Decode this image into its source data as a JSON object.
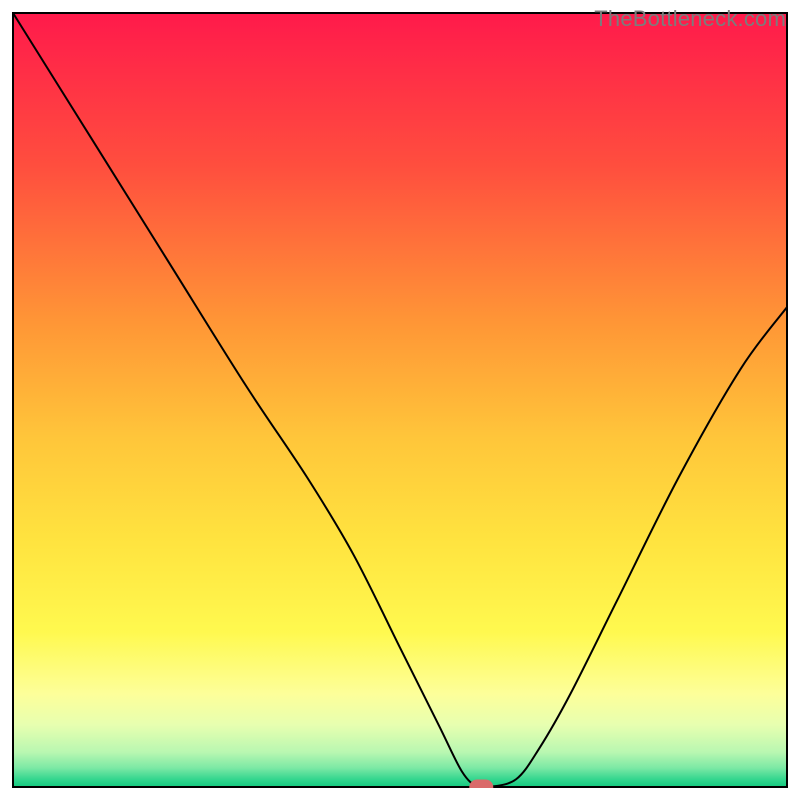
{
  "watermark": "TheBottleneck.com",
  "chart_data": {
    "type": "line",
    "title": "",
    "xlabel": "",
    "ylabel": "",
    "xlim": [
      0,
      100
    ],
    "ylim": [
      0,
      100
    ],
    "grid": false,
    "legend": null,
    "series": [
      {
        "name": "curve",
        "x": [
          0,
          10,
          20,
          30,
          38,
          44,
          50,
          55,
          58,
          60,
          61.5,
          65,
          68,
          72,
          78,
          86,
          94,
          100
        ],
        "y": [
          100,
          84,
          68,
          52,
          40,
          30,
          18,
          8,
          2,
          0,
          0,
          1,
          5,
          12,
          24,
          40,
          54,
          62
        ]
      }
    ],
    "marker": {
      "x": 60.5,
      "y": 0
    },
    "background": {
      "type": "vertical-gradient",
      "stops": [
        {
          "pos": 0.0,
          "color": "#ff1a4b"
        },
        {
          "pos": 0.2,
          "color": "#ff4f3e"
        },
        {
          "pos": 0.4,
          "color": "#ff9636"
        },
        {
          "pos": 0.55,
          "color": "#ffc63a"
        },
        {
          "pos": 0.68,
          "color": "#ffe33f"
        },
        {
          "pos": 0.8,
          "color": "#fff94f"
        },
        {
          "pos": 0.88,
          "color": "#fdff9a"
        },
        {
          "pos": 0.92,
          "color": "#e7ffb0"
        },
        {
          "pos": 0.955,
          "color": "#b9f7b1"
        },
        {
          "pos": 0.975,
          "color": "#7de9a5"
        },
        {
          "pos": 0.99,
          "color": "#34d68f"
        },
        {
          "pos": 1.0,
          "color": "#14c97e"
        }
      ]
    },
    "frame": {
      "stroke": "#000000",
      "width": 2
    },
    "curve_style": {
      "stroke": "#000000",
      "width": 2
    },
    "marker_style": {
      "fill": "#da6a6a",
      "rx": 8,
      "w": 24,
      "h": 15
    }
  }
}
